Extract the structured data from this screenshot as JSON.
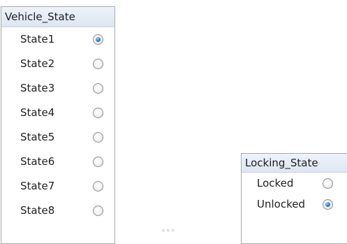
{
  "vehicle_panel": {
    "title": "Vehicle_State",
    "selected": "State1",
    "items": [
      {
        "label": "State1",
        "checked": true
      },
      {
        "label": "State2",
        "checked": false
      },
      {
        "label": "State3",
        "checked": false
      },
      {
        "label": "State4",
        "checked": false
      },
      {
        "label": "State5",
        "checked": false
      },
      {
        "label": "State6",
        "checked": false
      },
      {
        "label": "State7",
        "checked": false
      },
      {
        "label": "State8",
        "checked": false
      }
    ]
  },
  "locking_panel": {
    "title": "Locking_State",
    "selected": "Unlocked",
    "items": [
      {
        "label": "Locked",
        "checked": false
      },
      {
        "label": "Unlocked",
        "checked": true
      }
    ]
  },
  "colors": {
    "header_bg": "#dde6f2",
    "border": "#a9a9a9",
    "radio_selected": "#2b7fd1"
  }
}
